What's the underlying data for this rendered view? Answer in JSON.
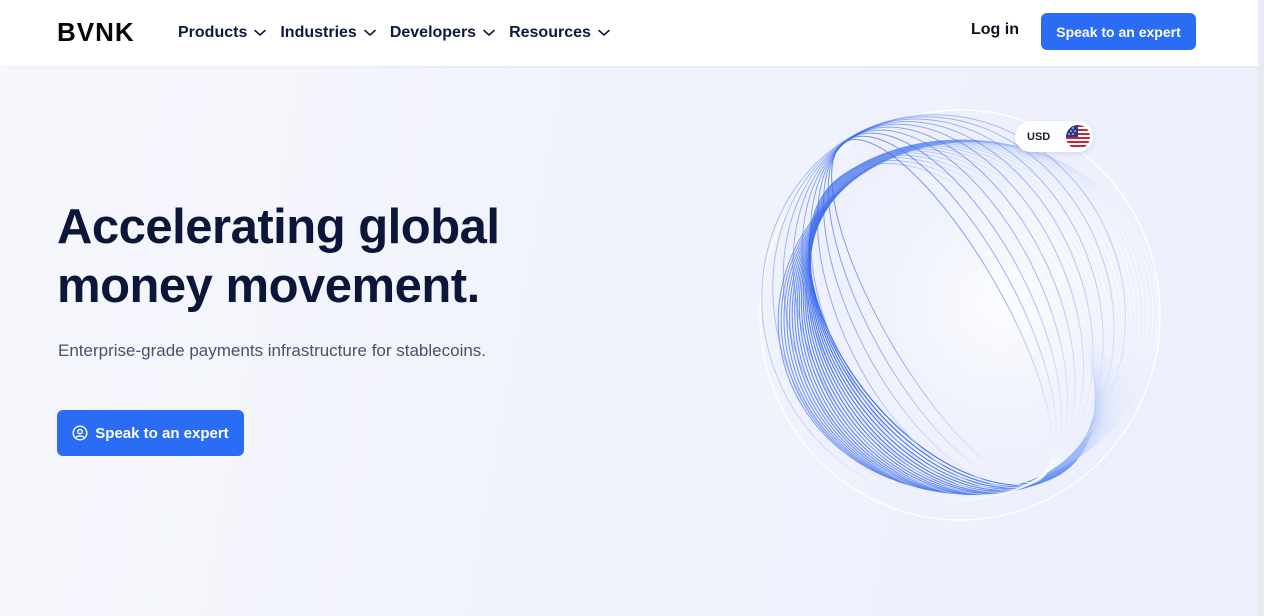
{
  "header": {
    "logo": "BVNK",
    "nav": [
      {
        "label": "Products"
      },
      {
        "label": "Industries"
      },
      {
        "label": "Developers"
      },
      {
        "label": "Resources"
      }
    ],
    "login_label": "Log in",
    "cta_label": "Speak to an expert"
  },
  "hero": {
    "title_line1": "Accelerating global",
    "title_line2": "money movement.",
    "subtitle": "Enterprise-grade payments infrastructure for stablecoins.",
    "cta_label": "Speak to an expert"
  },
  "currency_badge": {
    "label": "USD",
    "flag_icon": "us-flag-icon"
  },
  "colors": {
    "accent": "#2b6cf5",
    "heading": "#0b1638",
    "background": "#f4f6fc"
  }
}
